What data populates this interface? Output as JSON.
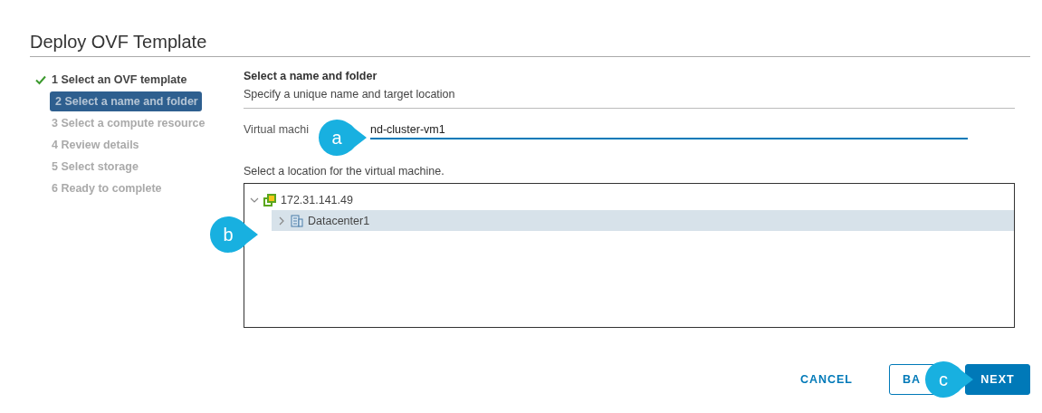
{
  "window": {
    "title": "Deploy OVF Template"
  },
  "steps": [
    {
      "label": "1 Select an OVF template",
      "completed": true,
      "selected": false
    },
    {
      "label": "2 Select a name and folder",
      "completed": false,
      "selected": true
    },
    {
      "label": "3 Select a compute resource",
      "completed": false,
      "selected": false
    },
    {
      "label": "4 Review details",
      "completed": false,
      "selected": false
    },
    {
      "label": "5 Select storage",
      "completed": false,
      "selected": false
    },
    {
      "label": "6 Ready to complete",
      "completed": false,
      "selected": false
    }
  ],
  "section": {
    "title": "Select a name and folder",
    "subtitle": "Specify a unique name and target location"
  },
  "name_field": {
    "label": "Virtual machi",
    "value": "nd-cluster-vm1"
  },
  "location_label": "Select a location for the virtual machine.",
  "tree": [
    {
      "label": "172.31.141.49",
      "kind": "host",
      "expanded": true,
      "selected": false,
      "children": [
        {
          "label": "Datacenter1",
          "kind": "datacenter",
          "expanded": false,
          "selected": true
        }
      ]
    }
  ],
  "buttons": [
    {
      "label": "CANCEL",
      "kind": "flat"
    },
    {
      "label": "BA",
      "kind": "outline"
    },
    {
      "label": "NEXT",
      "kind": "primary"
    }
  ],
  "callouts": [
    {
      "label": "a"
    },
    {
      "label": "b"
    },
    {
      "label": "c"
    }
  ]
}
